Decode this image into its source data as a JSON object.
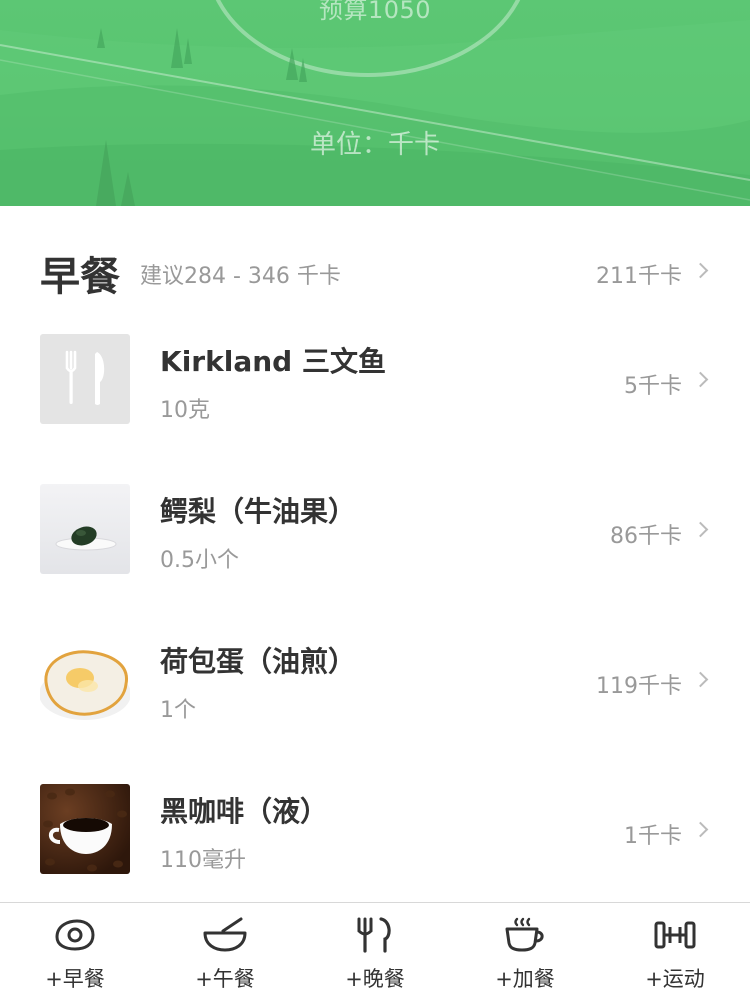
{
  "header": {
    "budget_text": "预算1050",
    "unit_text": "单位：千卡"
  },
  "meal": {
    "title": "早餐",
    "hint": "建议284 - 346 千卡",
    "total": "211千卡"
  },
  "foods": [
    {
      "name": "Kirkland 三文鱼",
      "quantity": "10克",
      "kcal": "5千卡",
      "image": "utensils-placeholder-icon"
    },
    {
      "name": "鳄梨（牛油果）",
      "quantity": "0.5小个",
      "kcal": "86千卡",
      "image": "avocado-photo"
    },
    {
      "name": "荷包蛋（油煎）",
      "quantity": "1个",
      "kcal": "119千卡",
      "image": "fried-egg-photo"
    },
    {
      "name": "黑咖啡（液）",
      "quantity": "110毫升",
      "kcal": "1千卡",
      "image": "coffee-photo"
    }
  ],
  "tabs": [
    {
      "label": "+早餐",
      "icon": "egg-icon"
    },
    {
      "label": "+午餐",
      "icon": "bowl-icon"
    },
    {
      "label": "+晚餐",
      "icon": "fork-knife-icon"
    },
    {
      "label": "+加餐",
      "icon": "cup-icon"
    },
    {
      "label": "+运动",
      "icon": "dumbbell-icon"
    }
  ],
  "colors": {
    "banner_green": "#58c36f",
    "text_primary": "#333333",
    "text_secondary": "#999999"
  }
}
